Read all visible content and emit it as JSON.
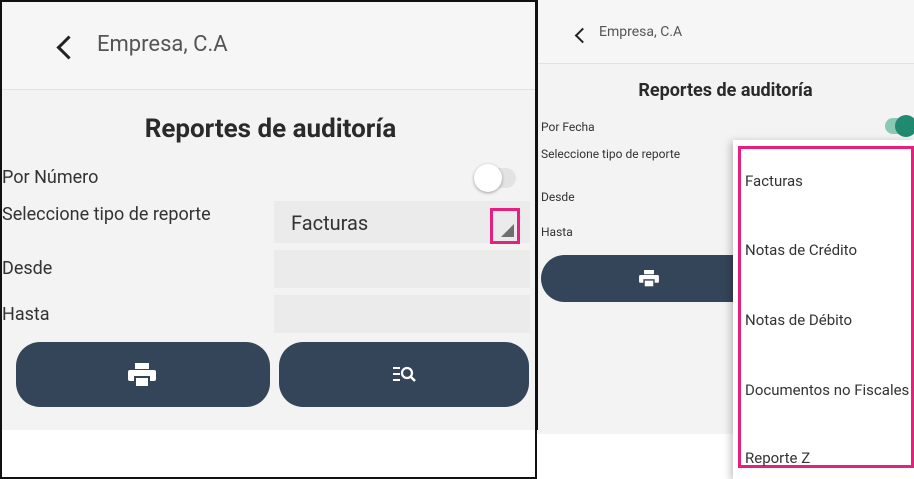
{
  "left": {
    "appbar": {
      "title": "Empresa, C.A"
    },
    "page_title": "Reportes de auditoría",
    "por_numero": {
      "label": "Por Número",
      "on": false
    },
    "tipo": {
      "label": "Seleccione tipo de reporte",
      "value": "Facturas"
    },
    "desde": {
      "label": "Desde",
      "value": ""
    },
    "hasta": {
      "label": "Hasta",
      "value": ""
    },
    "buttons": {
      "print_icon": "printer-icon",
      "search_icon": "search-list-icon"
    }
  },
  "right": {
    "appbar": {
      "title": "Empresa, C.A"
    },
    "page_title": "Reportes de auditoría",
    "por_fecha": {
      "label": "Por Fecha",
      "on": true
    },
    "tipo": {
      "label": "Seleccione tipo de reporte"
    },
    "desde": {
      "label": "Desde"
    },
    "hasta": {
      "label": "Hasta"
    },
    "dropdown_options": [
      "Facturas",
      "Notas de Crédito",
      "Notas de Débito",
      "Documentos no Fiscales",
      "Reporte Z"
    ]
  },
  "colors": {
    "button": "#344559",
    "highlight": "#e6207f",
    "toggle_on": "#1f8a6f"
  }
}
